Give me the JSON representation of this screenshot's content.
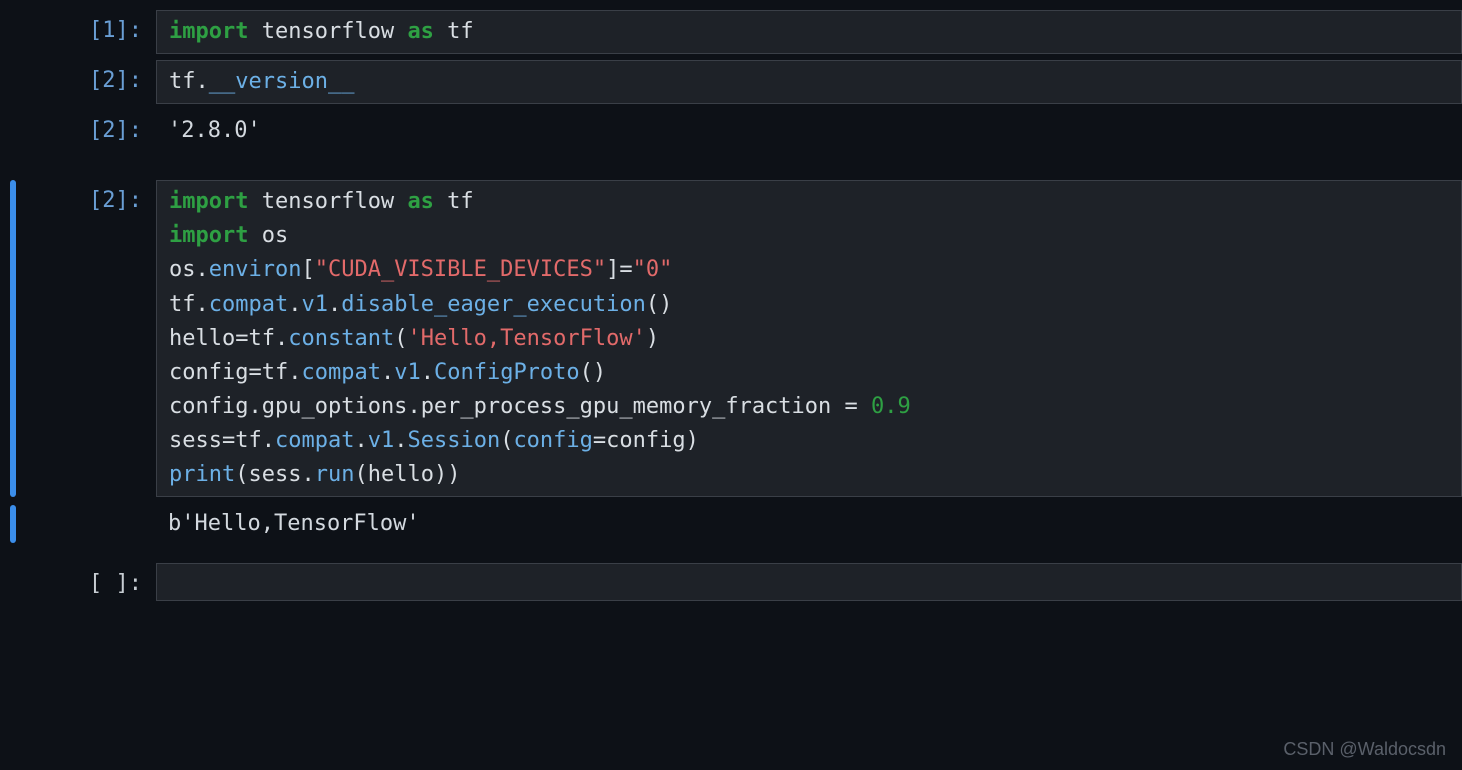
{
  "prompts": {
    "cell1_in": "[1]:",
    "cell2_in": "[2]:",
    "cell2_out": "[2]:",
    "cell3_in": "[2]:",
    "cell_blank": "[ ]:"
  },
  "cell1": {
    "import": "import",
    "as": "as",
    "tensorflow": " tensorflow ",
    "tf": " tf"
  },
  "cell2_in": {
    "tf": "tf",
    "dot": ".",
    "version": "__version__"
  },
  "cell2_out": "'2.8.0'",
  "cell3": {
    "l1": {
      "import": "import",
      "mid": " tensorflow ",
      "as": "as",
      "tf": " tf"
    },
    "l2": {
      "import": "import",
      "os": " os"
    },
    "l3": {
      "os": "os",
      "dot": ".",
      "environ": "environ",
      "br1": "[",
      "key": "\"CUDA_VISIBLE_DEVICES\"",
      "br2": "]",
      "eq": "=",
      "val": "\"0\""
    },
    "l4": {
      "tf": "tf",
      "d1": ".",
      "compat": "compat",
      "d2": ".",
      "v1": "v1",
      "d3": ".",
      "fn": "disable_eager_execution",
      "paren": "()"
    },
    "l5": {
      "hello": "hello",
      "eq": "=",
      "tf": "tf",
      "d1": ".",
      "constant": "constant",
      "open": "(",
      "str": "'Hello,TensorFlow'",
      "close": ")"
    },
    "l6": {
      "config": "config",
      "eq": "=",
      "tf": "tf",
      "d1": ".",
      "compat": "compat",
      "d2": ".",
      "v1": "v1",
      "d3": ".",
      "cp": "ConfigProto",
      "paren": "()"
    },
    "l7": {
      "config": "config",
      "d1": ".",
      "go": "gpu_options",
      "d2": ".",
      "frac": "per_process_gpu_memory_fraction",
      "sp1": " ",
      "eq": "=",
      "sp2": " ",
      "num": "0.9"
    },
    "l8": {
      "sess": "sess",
      "eq": "=",
      "tf": "tf",
      "d1": ".",
      "compat": "compat",
      "d2": ".",
      "v1": "v1",
      "d3": ".",
      "Session": "Session",
      "open": "(",
      "cfg1": "config",
      "eq2": "=",
      "cfg2": "config",
      "close": ")"
    },
    "l9": {
      "print": "print",
      "open": "(",
      "sess": "sess",
      "d1": ".",
      "run": "run",
      "open2": "(",
      "hello": "hello",
      "close2": ")",
      "close": ")"
    }
  },
  "cell3_out": "b'Hello,TensorFlow'",
  "cell4_code": "",
  "watermark": "CSDN @Waldocsdn"
}
